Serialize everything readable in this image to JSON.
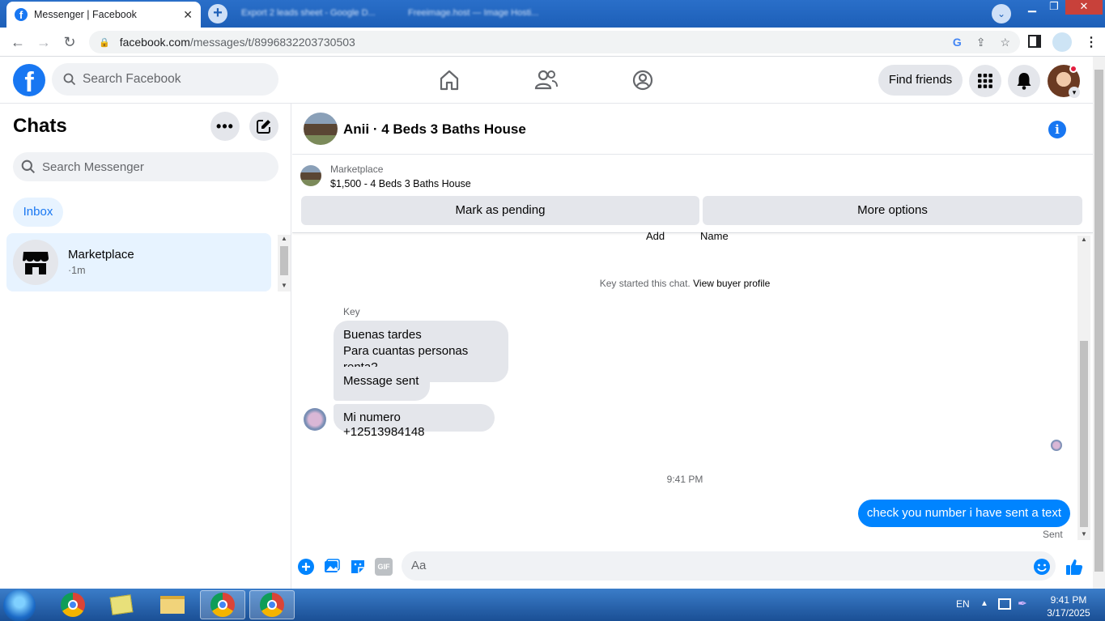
{
  "browser": {
    "tab_title": "Messenger | Facebook",
    "bg_tab_1": "Export 2 leads sheet - Google D...",
    "bg_tab_2": "Freeimage.host — Image Hosti...",
    "url_domain": "facebook.com",
    "url_path": "/messages/t/8996832203730503"
  },
  "header": {
    "search_placeholder": "Search Facebook",
    "find_friends": "Find friends"
  },
  "sidebar": {
    "title": "Chats",
    "search_placeholder": "Search Messenger",
    "inbox_label": "Inbox",
    "conversations": [
      {
        "name": "Marketplace",
        "time": "·1m"
      }
    ]
  },
  "chat": {
    "title": "Anii · 4 Beds 3 Baths House",
    "marketplace_label": "Marketplace",
    "listing": "$1,500 - 4 Beds 3 Baths House",
    "mark_pending": "Mark as pending",
    "more_options": "More options",
    "cut_text_1": "Add",
    "cut_text_2": "Name",
    "started_text": "Key started this chat.",
    "view_buyer_profile": "View buyer profile",
    "sender_name": "Key",
    "messages_in": [
      {
        "line1": "Buenas tardes",
        "line2": "Para cuantas personas renta?"
      },
      {
        "text": "Message sent"
      },
      {
        "text": "Mi numero +12513984148"
      }
    ],
    "timestamp": "9:41 PM",
    "message_out": "check you number i have sent a text",
    "status": "Sent",
    "composer_placeholder": "Aa",
    "gif_label": "GIF"
  },
  "taskbar": {
    "lang": "EN",
    "time": "9:41 PM",
    "date": "3/17/2025"
  },
  "colors": {
    "brand": "#1877f2",
    "outgoing_bubble": "#0084ff",
    "incoming_bubble": "#e4e6eb"
  }
}
